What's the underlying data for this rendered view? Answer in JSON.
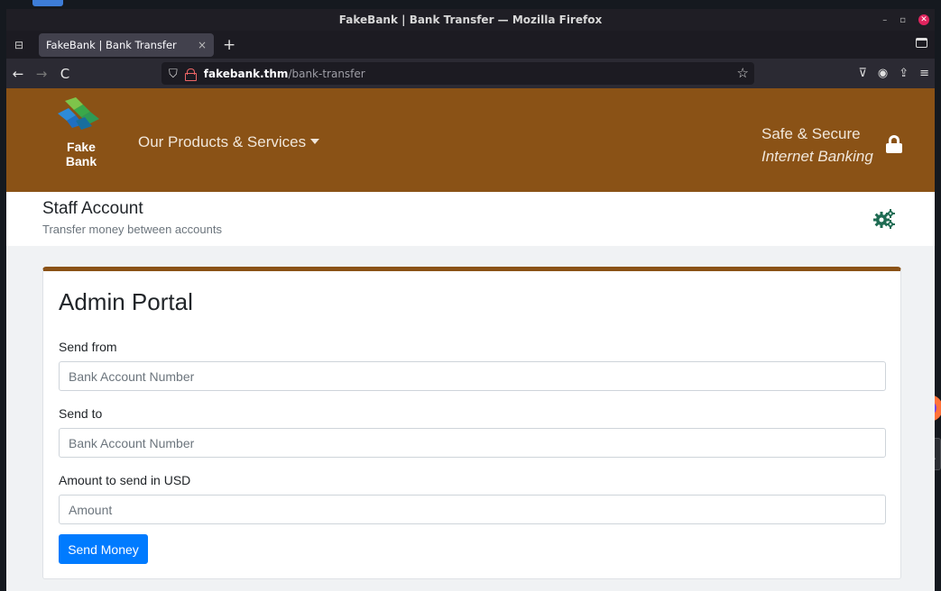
{
  "window": {
    "title": "FakeBank | Bank Transfer — Mozilla Firefox",
    "controls": {
      "minimize": "–",
      "maximize": "▫",
      "close": "✕"
    }
  },
  "browser": {
    "tab_title": "FakeBank | Bank Transfer",
    "tab_close": "×",
    "new_tab": "+",
    "url_host": "fakebank.thm",
    "url_path": "/bank-transfer",
    "nav": {
      "back": "←",
      "forward": "→",
      "reload": "C"
    }
  },
  "site": {
    "logo_line1": "Fake",
    "logo_line2": "Bank",
    "products_menu": "Our Products & Services",
    "tagline_line1": "Safe & Secure",
    "tagline_line2": "Internet Banking",
    "brand_color": "#8a5216"
  },
  "subheader": {
    "title": "Staff Account",
    "subtitle": "Transfer money between accounts"
  },
  "form": {
    "heading": "Admin Portal",
    "send_from_label": "Send from",
    "send_from_placeholder": "Bank Account Number",
    "send_to_label": "Send to",
    "send_to_placeholder": "Bank Account Number",
    "amount_label": "Amount to send in USD",
    "amount_placeholder": "Amount",
    "submit_label": "Send Money",
    "accent_color": "#007bff"
  },
  "icons": [
    "hamburger-icon",
    "firefox-icon",
    "terminal-icon",
    "list-tabs-icon",
    "shield-icon",
    "lock-icon",
    "star-icon",
    "pocket-icon",
    "account-icon",
    "extensions-icon",
    "menu-icon",
    "gears-icon",
    "padlock-icon"
  ]
}
